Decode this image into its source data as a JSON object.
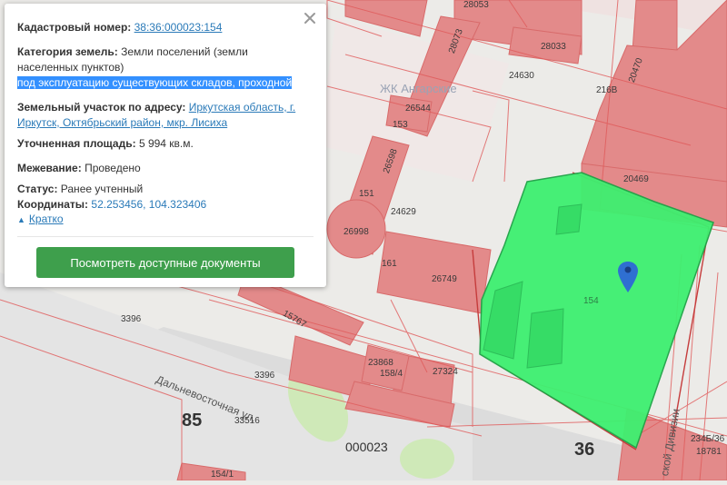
{
  "map": {
    "labels": {
      "28053": "28053",
      "28033": "28033",
      "28073": "28073",
      "24630": "24630",
      "216B": "216В",
      "20470": "20470",
      "26544": "26544",
      "153": "153",
      "26598": "26598",
      "20469": "20469",
      "151": "151",
      "24629": "24629",
      "26998": "26998",
      "161": "161",
      "26749": "26749",
      "154": "154",
      "15767": "15767",
      "3396a": "3396",
      "3396b": "3396",
      "23868": "23868",
      "158_4": "158/4",
      "27324": "27324",
      "85": "85",
      "33516": "33516",
      "000023": "000023",
      "36": "36",
      "234B_36": "234Б/36",
      "18781": "18781",
      "154_1": "154/1",
      "complex": "ЖК Ангарские",
      "street1": "Дальневосточная ул.",
      "street2": "ской Дивизии"
    },
    "colors": {
      "parcel_fill": "#3ef070",
      "building_fill": "#e38a8a",
      "boundary": "#e05a5a",
      "marker": "#2f6fd1"
    }
  },
  "popup": {
    "cadastral_label": "Кадастровый номер:",
    "cadastral_value": "38:36:000023:154",
    "category_label": "Категория земель:",
    "category_value": "Земли поселений (земли населенных пунктов)",
    "purpose_value": "под эксплуатацию существующих складов, проходной",
    "address_label": "Земельный участок по адресу:",
    "address_value": "Иркутская область, г. Иркутск, Октябрьский район, мкр. Лисиха",
    "area_label": "Уточненная площадь:",
    "area_value": "5 994 кв.м.",
    "survey_label": "Межевание:",
    "survey_value": "Проведено",
    "status_label": "Статус:",
    "status_value": "Ранее учтенный",
    "coords_label": "Координаты:",
    "coords_value": "52.253456, 104.323406",
    "collapse_label": "Кратко",
    "docs_button": "Посмотреть доступные документы",
    "close_icon": "close-icon"
  }
}
